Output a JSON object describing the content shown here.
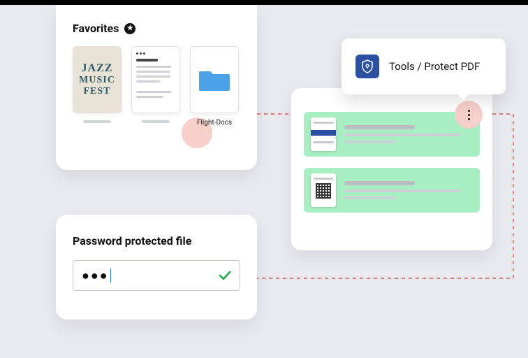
{
  "favorites": {
    "title": "Favorites",
    "items": [
      {
        "type": "poster",
        "jazz_l1": "JAZZ",
        "jazz_l2": "MUSIC",
        "jazz_l3": "FEST"
      },
      {
        "type": "document"
      },
      {
        "type": "folder",
        "label": "Flight-Docs"
      }
    ]
  },
  "tooltip": {
    "label": "Tools / Protect PDF"
  },
  "password_panel": {
    "title": "Password protected file",
    "value_masked": "●●●"
  }
}
